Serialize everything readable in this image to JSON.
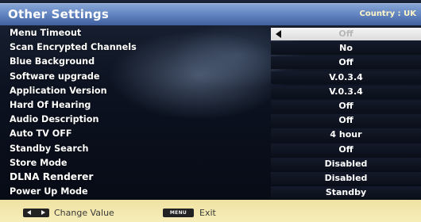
{
  "header": {
    "title": "Other Settings",
    "country": "Country : UK"
  },
  "settings": [
    {
      "label": "Menu Timeout",
      "value": "Off"
    },
    {
      "label": "Scan Encrypted Channels",
      "value": "No"
    },
    {
      "label": "Blue Background",
      "value": "Off"
    },
    {
      "label": "Software upgrade",
      "value": "V.0.3.4"
    },
    {
      "label": "Application Version",
      "value": "V.0.3.4"
    },
    {
      "label": "Hard Of Hearing",
      "value": "Off"
    },
    {
      "label": "Audio Description",
      "value": "Off"
    },
    {
      "label": "Auto TV OFF",
      "value": "4 hour"
    },
    {
      "label": "Standby Search",
      "value": "Off"
    },
    {
      "label": "Store Mode",
      "value": "Disabled"
    },
    {
      "label": "DLNA Renderer",
      "value": "Disabled"
    },
    {
      "label": "Power Up Mode",
      "value": "Standby"
    }
  ],
  "footer": {
    "change_label": "Change Value",
    "menu_key": "MENU",
    "exit_label": "Exit"
  },
  "colors": {
    "header_accent": "#5f82bf",
    "footer_band": "#f2e7a8",
    "selected_value_bg": "#e9e9e9"
  },
  "icons": {
    "left_arrow": "left-arrow-icon",
    "left_right_key": "left-right-key-icon",
    "menu_key": "menu-key-icon"
  }
}
